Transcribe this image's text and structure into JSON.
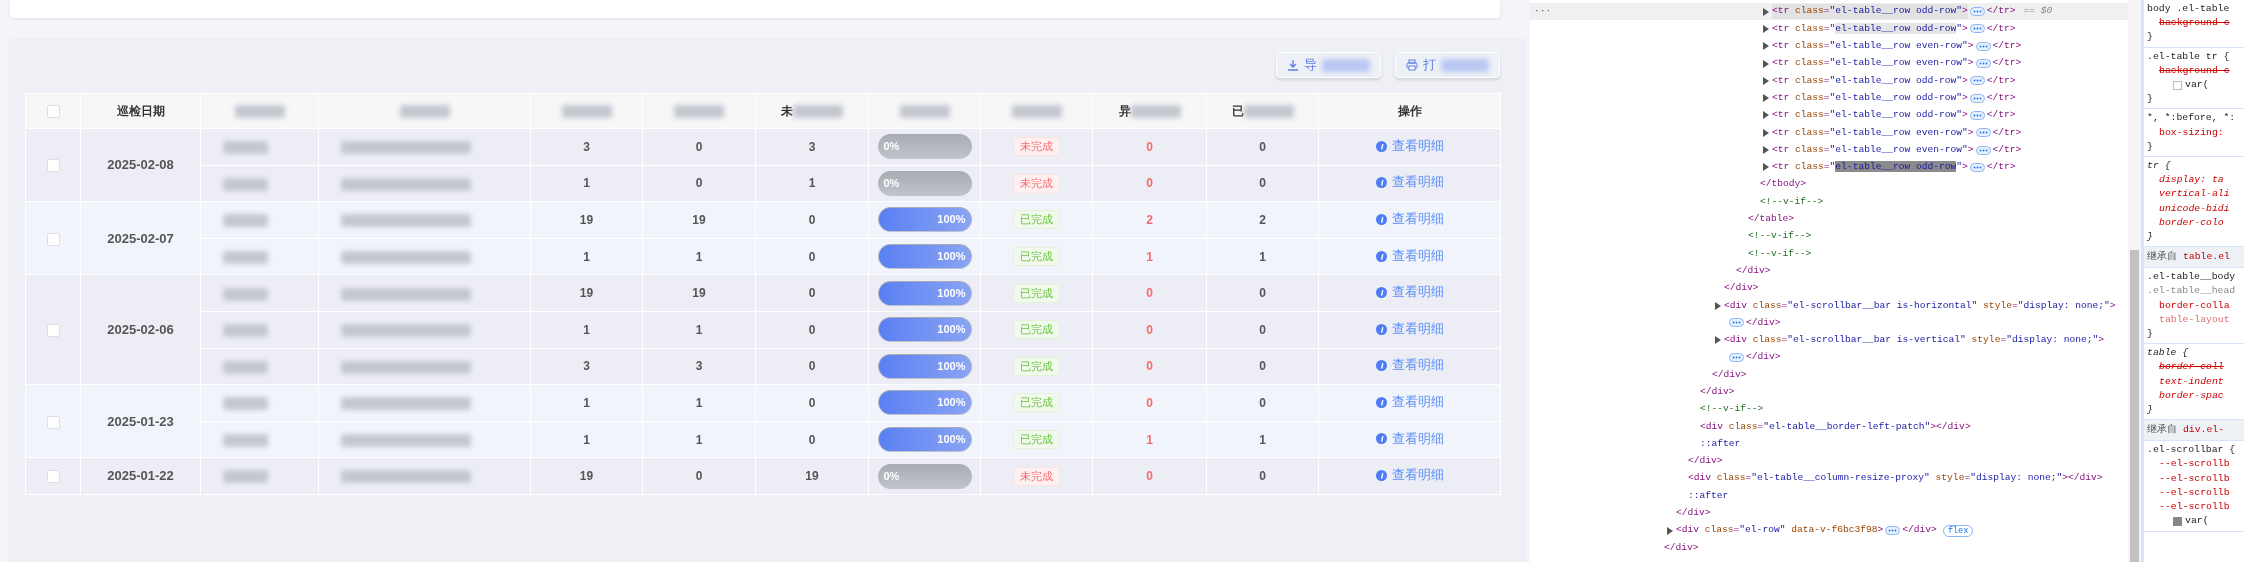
{
  "toolbar": {
    "buttons": [
      {
        "kind": "download",
        "label": "导",
        "redacted": true
      },
      {
        "kind": "print",
        "label": "打",
        "redacted": true
      }
    ]
  },
  "table": {
    "columns": [
      {
        "kind": "checkbox",
        "checked": false
      },
      {
        "kind": "text",
        "label": "巡检日期"
      },
      {
        "kind": "text",
        "redacted": true
      },
      {
        "kind": "text",
        "redacted": true
      },
      {
        "kind": "text",
        "redacted": true
      },
      {
        "kind": "text",
        "redacted": true
      },
      {
        "kind": "text",
        "label": "未",
        "redacted": true
      },
      {
        "kind": "text",
        "redacted": true
      },
      {
        "kind": "text",
        "redacted": true
      },
      {
        "kind": "text",
        "label": "异",
        "redacted": true
      },
      {
        "kind": "text",
        "label": "已",
        "redacted": true
      },
      {
        "kind": "text",
        "label": "操作"
      }
    ],
    "groups": [
      {
        "date": "2025-02-08",
        "checked": false,
        "rows": [
          {
            "person": {
              "redacted": true
            },
            "task": {
              "redacted": true
            },
            "total": "3",
            "done": "0",
            "undone": "3",
            "progress": {
              "level": 0,
              "label": "0%"
            },
            "status": {
              "kind": "pending",
              "label": "未完成"
            },
            "abnormal": "0",
            "handled": "0",
            "action": "查看明细"
          },
          {
            "person": {
              "redacted": true
            },
            "task": {
              "redacted": true
            },
            "total": "1",
            "done": "0",
            "undone": "1",
            "progress": {
              "level": 0,
              "label": "0%"
            },
            "status": {
              "kind": "pending",
              "label": "未完成"
            },
            "abnormal": "0",
            "handled": "0",
            "action": "查看明细"
          }
        ]
      },
      {
        "date": "2025-02-07",
        "checked": false,
        "rows": [
          {
            "person": {
              "redacted": true
            },
            "task": {
              "redacted": true
            },
            "total": "19",
            "done": "19",
            "undone": "0",
            "progress": {
              "level": 1,
              "label": "100%"
            },
            "status": {
              "kind": "done",
              "label": "已完成"
            },
            "abnormal": "2",
            "handled": "2",
            "action": "查看明细"
          },
          {
            "person": {
              "redacted": true
            },
            "task": {
              "redacted": true
            },
            "total": "1",
            "done": "1",
            "undone": "0",
            "progress": {
              "level": 1,
              "label": "100%"
            },
            "status": {
              "kind": "done",
              "label": "已完成"
            },
            "abnormal": "1",
            "handled": "1",
            "action": "查看明细"
          }
        ]
      },
      {
        "date": "2025-02-06",
        "checked": false,
        "rows": [
          {
            "person": {
              "redacted": true
            },
            "task": {
              "redacted": true
            },
            "total": "19",
            "done": "19",
            "undone": "0",
            "progress": {
              "level": 1,
              "label": "100%"
            },
            "status": {
              "kind": "done",
              "label": "已完成"
            },
            "abnormal": "0",
            "handled": "0",
            "action": "查看明细"
          },
          {
            "person": {
              "redacted": true
            },
            "task": {
              "redacted": true
            },
            "total": "1",
            "done": "1",
            "undone": "0",
            "progress": {
              "level": 1,
              "label": "100%"
            },
            "status": {
              "kind": "done",
              "label": "已完成"
            },
            "abnormal": "0",
            "handled": "0",
            "action": "查看明细"
          },
          {
            "person": {
              "redacted": true
            },
            "task": {
              "redacted": true
            },
            "total": "3",
            "done": "3",
            "undone": "0",
            "progress": {
              "level": 1,
              "label": "100%"
            },
            "status": {
              "kind": "done",
              "label": "已完成"
            },
            "abnormal": "0",
            "handled": "0",
            "action": "查看明细"
          }
        ]
      },
      {
        "date": "2025-01-23",
        "checked": false,
        "rows": [
          {
            "person": {
              "redacted": true
            },
            "task": {
              "redacted": true
            },
            "total": "1",
            "done": "1",
            "undone": "0",
            "progress": {
              "level": 1,
              "label": "100%"
            },
            "status": {
              "kind": "done",
              "label": "已完成"
            },
            "abnormal": "0",
            "handled": "0",
            "action": "查看明细"
          },
          {
            "person": {
              "redacted": true
            },
            "task": {
              "redacted": true
            },
            "total": "1",
            "done": "1",
            "undone": "0",
            "progress": {
              "level": 1,
              "label": "100%"
            },
            "status": {
              "kind": "done",
              "label": "已完成"
            },
            "abnormal": "1",
            "handled": "1",
            "action": "查看明细"
          }
        ]
      },
      {
        "date": "2025-01-22",
        "checked": false,
        "rows": [
          {
            "person": {
              "redacted": true
            },
            "task": {
              "redacted": true
            },
            "total": "19",
            "done": "0",
            "undone": "19",
            "progress": {
              "level": 0,
              "label": "0%"
            },
            "status": {
              "kind": "pending",
              "label": "未完成"
            },
            "abnormal": "0",
            "handled": "0",
            "action": "查看明细"
          }
        ]
      }
    ]
  },
  "elements_panel": {
    "tree": [
      {
        "close": "</div>",
        "children": [
          {
            "close": "</div>",
            "children": [
              {
                "close": "</div>",
                "children": [
                  {
                    "close": "</div>",
                    "children": [
                      {
                        "close": "</div>",
                        "children": [
                          {
                            "close": "</div>",
                            "children": [
                              {
                                "close": "</div>",
                                "children": [
                                  {
                                    "close": "</table>",
                                    "children": [
                                      {
                                        "close": "</tbody>",
                                        "children": [
                                          {
                                            "kind": "element",
                                            "text": "<tr class=\"el-table__row odd-row\">",
                                            "collapsed": true,
                                            "end": "</tr>",
                                            "selected": true,
                                            "highlighted": false,
                                            "gutter": "···",
                                            "suffix": "== $0"
                                          },
                                          {
                                            "kind": "element",
                                            "text": "<tr class=\"el-table__row odd-row\">",
                                            "collapsed": true,
                                            "end": "</tr>",
                                            "selected": false,
                                            "highlighted": true,
                                            "active_match": false
                                          },
                                          {
                                            "kind": "element",
                                            "text": "<tr class=\"el-table__row even-row\">",
                                            "collapsed": true,
                                            "end": "</tr>",
                                            "selected": false,
                                            "highlighted": false
                                          },
                                          {
                                            "kind": "element",
                                            "text": "<tr class=\"el-table__row even-row\">",
                                            "collapsed": true,
                                            "end": "</tr>",
                                            "selected": false,
                                            "highlighted": false
                                          },
                                          {
                                            "kind": "element",
                                            "text": "<tr class=\"el-table__row odd-row\">",
                                            "collapsed": true,
                                            "end": "</tr>",
                                            "selected": false,
                                            "highlighted": false
                                          },
                                          {
                                            "kind": "element",
                                            "text": "<tr class=\"el-table__row odd-row\">",
                                            "collapsed": true,
                                            "end": "</tr>",
                                            "selected": false,
                                            "highlighted": false
                                          },
                                          {
                                            "kind": "element",
                                            "text": "<tr class=\"el-table__row odd-row\">",
                                            "collapsed": true,
                                            "end": "</tr>",
                                            "selected": false,
                                            "highlighted": false
                                          },
                                          {
                                            "kind": "element",
                                            "text": "<tr class=\"el-table__row even-row\">",
                                            "collapsed": true,
                                            "end": "</tr>",
                                            "selected": false,
                                            "highlighted": false
                                          },
                                          {
                                            "kind": "element",
                                            "text": "<tr class=\"el-table__row even-row\">",
                                            "collapsed": true,
                                            "end": "</tr>",
                                            "selected": false,
                                            "highlighted": false
                                          },
                                          {
                                            "kind": "element",
                                            "text": "<tr class=\"el-table__row odd-row\">",
                                            "collapsed": true,
                                            "end": "</tr>",
                                            "selected": false,
                                            "highlighted": true,
                                            "active_match": true
                                          }
                                        ]
                                      },
                                      {
                                        "kind": "comment",
                                        "text": "<!--v-if-->"
                                      }
                                    ]
                                  },
                                  {
                                    "kind": "comment",
                                    "text": "<!--v-if-->"
                                  },
                                  {
                                    "kind": "comment",
                                    "text": "<!--v-if-->"
                                  }
                                ]
                              }
                            ]
                          },
                          {
                            "kind": "element",
                            "text": "<div class=\"el-scrollbar__bar is-horizontal\" style=\"display: none;\">",
                            "collapsed": true,
                            "wrapped": true,
                            "end": "</div>"
                          },
                          {
                            "kind": "element",
                            "text": "<div class=\"el-scrollbar__bar is-vertical\" style=\"display: none;\">",
                            "collapsed": true,
                            "wrapped": true,
                            "end": "</div>"
                          }
                        ]
                      }
                    ]
                  },
                  {
                    "kind": "comment",
                    "text": "<!--v-if-->"
                  },
                  {
                    "kind": "element",
                    "text": "<div class=\"el-table__border-left-patch\"></div>",
                    "collapsed": false
                  },
                  {
                    "kind": "pseudo",
                    "text": "::after"
                  }
                ]
              },
              {
                "kind": "element",
                "text": "<div class=\"el-table__column-resize-proxy\" style=\"display: none;\"></div>",
                "collapsed": false
              },
              {
                "kind": "pseudo",
                "text": "::after"
              }
            ]
          },
          {
            "kind": "element",
            "text": "<div class=\"el-row\" data-v-f6bc3f98>",
            "collapsed": true,
            "end": "</div>",
            "badge": "flex"
          }
        ]
      }
    ]
  },
  "styles_panel": {
    "blocks": [
      {
        "kind": "rule",
        "lines": [
          {
            "kind": "selector",
            "text": "body .el-table"
          },
          {
            "kind": "struck",
            "text": "background-c"
          },
          {
            "kind": "brace",
            "text": "}"
          }
        ]
      },
      {
        "kind": "rule",
        "lines": [
          {
            "kind": "selector",
            "text": ".el-table tr {"
          },
          {
            "kind": "struck",
            "text": "background-c"
          },
          {
            "kind": "swatch",
            "text": "var(",
            "checked": false
          },
          {
            "kind": "brace",
            "text": "}"
          }
        ]
      },
      {
        "kind": "rule",
        "lines": [
          {
            "kind": "selector",
            "text": "*, *:before, *:"
          },
          {
            "kind": "prop",
            "text": "box-sizing:"
          },
          {
            "kind": "brace",
            "text": "}"
          }
        ]
      },
      {
        "kind": "rule",
        "lines": [
          {
            "kind": "ua-selector",
            "text": "tr {"
          },
          {
            "kind": "ua-prop",
            "text": "display: ta"
          },
          {
            "kind": "ua-prop",
            "text": "vertical-ali"
          },
          {
            "kind": "ua-prop",
            "text": "unicode-bidi"
          },
          {
            "kind": "ua-prop",
            "text": "border-colo"
          },
          {
            "kind": "ua-brace",
            "text": "}"
          }
        ]
      },
      {
        "kind": "inherited",
        "label": "继承自",
        "source": "table.el"
      },
      {
        "kind": "rule",
        "lines": [
          {
            "kind": "selector",
            "text": ".el-table__body"
          },
          {
            "kind": "selector-dim",
            "text": ".el-table__head"
          },
          {
            "kind": "prop",
            "text": "border-colla"
          },
          {
            "kind": "prop-dim",
            "text": "table-layout"
          },
          {
            "kind": "brace",
            "text": "}"
          }
        ]
      },
      {
        "kind": "rule",
        "lines": [
          {
            "kind": "ua-selector",
            "text": "table {"
          },
          {
            "kind": "ua-struck",
            "text": "border-coll"
          },
          {
            "kind": "ua-prop",
            "text": "text-indent"
          },
          {
            "kind": "ua-prop",
            "text": "border-spac"
          },
          {
            "kind": "ua-brace",
            "text": "}"
          }
        ]
      },
      {
        "kind": "inherited",
        "label": "继承自",
        "source": "div.el-"
      },
      {
        "kind": "rule",
        "lines": [
          {
            "kind": "selector",
            "text": ".el-scrollbar {"
          },
          {
            "kind": "prop",
            "text": "--el-scrollb"
          },
          {
            "kind": "prop",
            "text": "--el-scrollb"
          },
          {
            "kind": "prop",
            "text": "--el-scrollb"
          },
          {
            "kind": "prop",
            "text": "--el-scrollb"
          },
          {
            "kind": "swatch-var",
            "text": "var("
          }
        ]
      }
    ]
  }
}
